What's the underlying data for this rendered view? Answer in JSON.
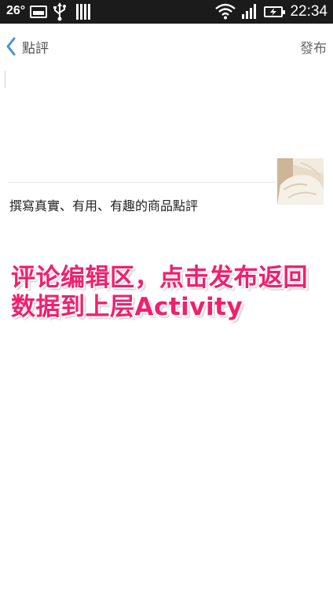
{
  "status_bar": {
    "temperature": "26°",
    "time": "22:34",
    "icons": [
      "image-icon",
      "usb-icon",
      "bars-icon",
      "wifi-icon",
      "signal-icon",
      "battery-charging-icon"
    ]
  },
  "nav": {
    "back_icon": "chevron-left-icon",
    "title": "點評",
    "publish_label": "發布",
    "accent_color": "#4a90d9"
  },
  "editor": {
    "comment_value": "",
    "hint": "撰寫真實、有用、有趣的商品點評",
    "thumbnail": "product-thumbnail"
  },
  "annotation": {
    "line1": "评论编辑区，点击发布返回",
    "line2": "数据到上层Activity",
    "color": "#f0206e"
  }
}
